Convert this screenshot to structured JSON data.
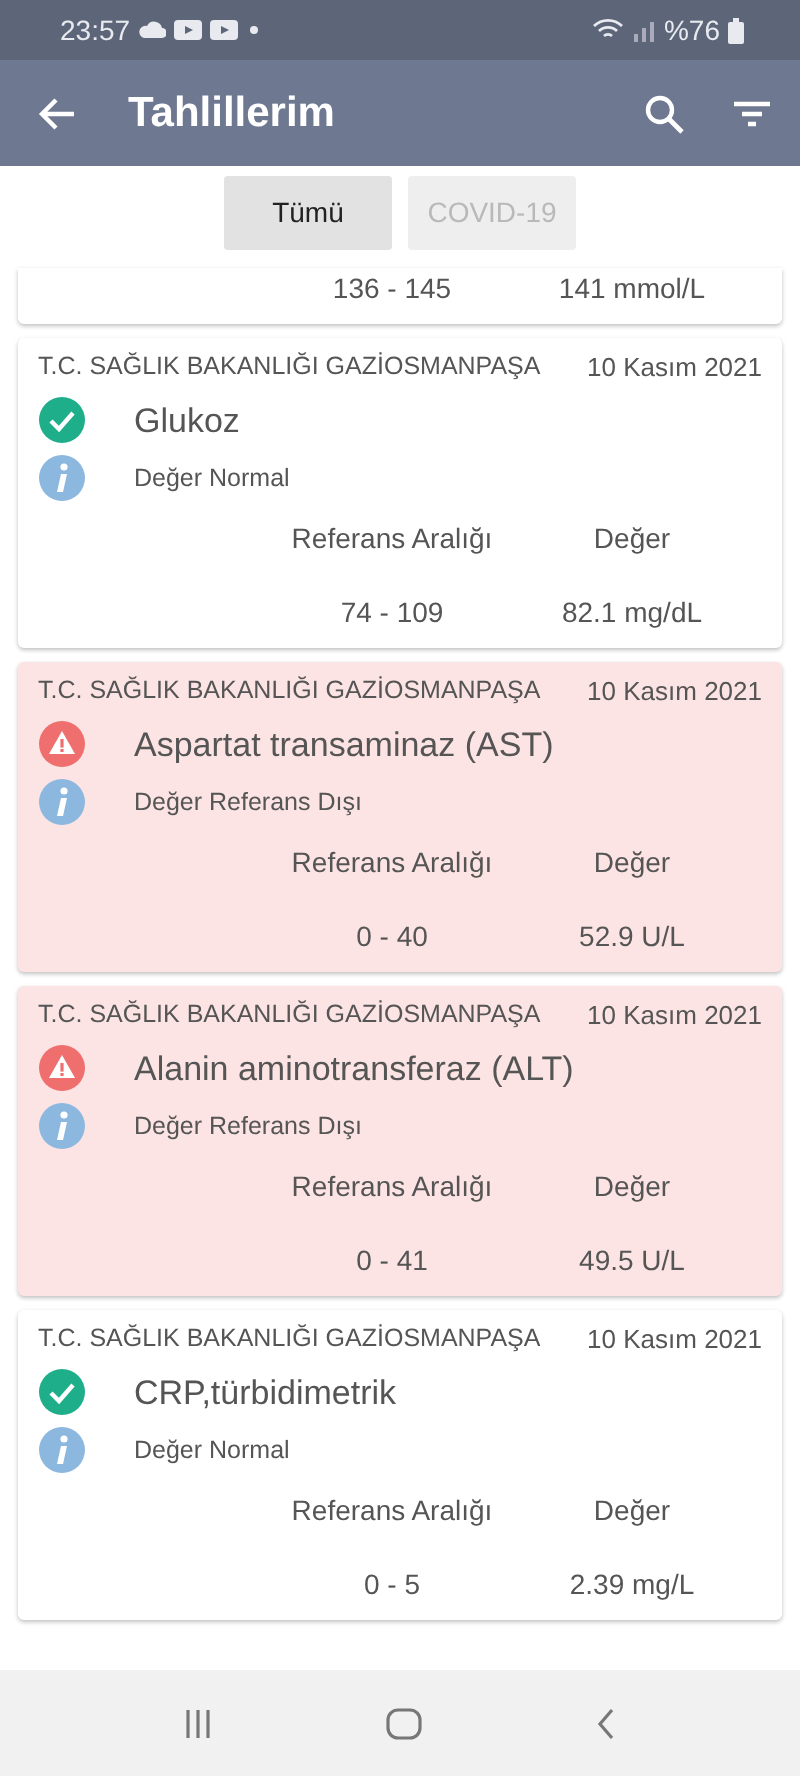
{
  "status_bar": {
    "time": "23:57",
    "battery": "%76"
  },
  "app_bar": {
    "title": "Tahlillerim"
  },
  "filters": [
    {
      "label": "Tümü",
      "selected": true
    },
    {
      "label": "COVID-19",
      "selected": false
    }
  ],
  "results": [
    {
      "range": "136 - 145",
      "value": "141 mmol/L"
    },
    {
      "source": "T.C. SAĞLIK BAKANLIĞI GAZİOSMANPAŞA",
      "date": "10 Kasım 2021",
      "kind": "normal",
      "test": "Glukoz",
      "note": "Değer Normal",
      "range_label": "Referans Aralığı",
      "value_label": "Değer",
      "range": "74 - 109",
      "value": "82.1 mg/dL"
    },
    {
      "source": "T.C. SAĞLIK BAKANLIĞI GAZİOSMANPAŞA",
      "date": "10 Kasım 2021",
      "kind": "abnormal",
      "test": "Aspartat transaminaz (AST)",
      "note": "Değer Referans Dışı",
      "range_label": "Referans Aralığı",
      "value_label": "Değer",
      "range": "0 - 40",
      "value": "52.9 U/L"
    },
    {
      "source": "T.C. SAĞLIK BAKANLIĞI GAZİOSMANPAŞA",
      "date": "10 Kasım 2021",
      "kind": "abnormal",
      "test": "Alanin aminotransferaz (ALT)",
      "note": "Değer Referans Dışı",
      "range_label": "Referans Aralığı",
      "value_label": "Değer",
      "range": "0 - 41",
      "value": "49.5 U/L"
    },
    {
      "source": "T.C. SAĞLIK BAKANLIĞI GAZİOSMANPAŞA",
      "date": "10 Kasım 2021",
      "kind": "normal",
      "test": "CRP,türbidimetrik",
      "note": "Değer Normal",
      "range_label": "Referans Aralığı",
      "value_label": "Değer",
      "range": "0 - 5",
      "value": "2.39 mg/L"
    }
  ]
}
